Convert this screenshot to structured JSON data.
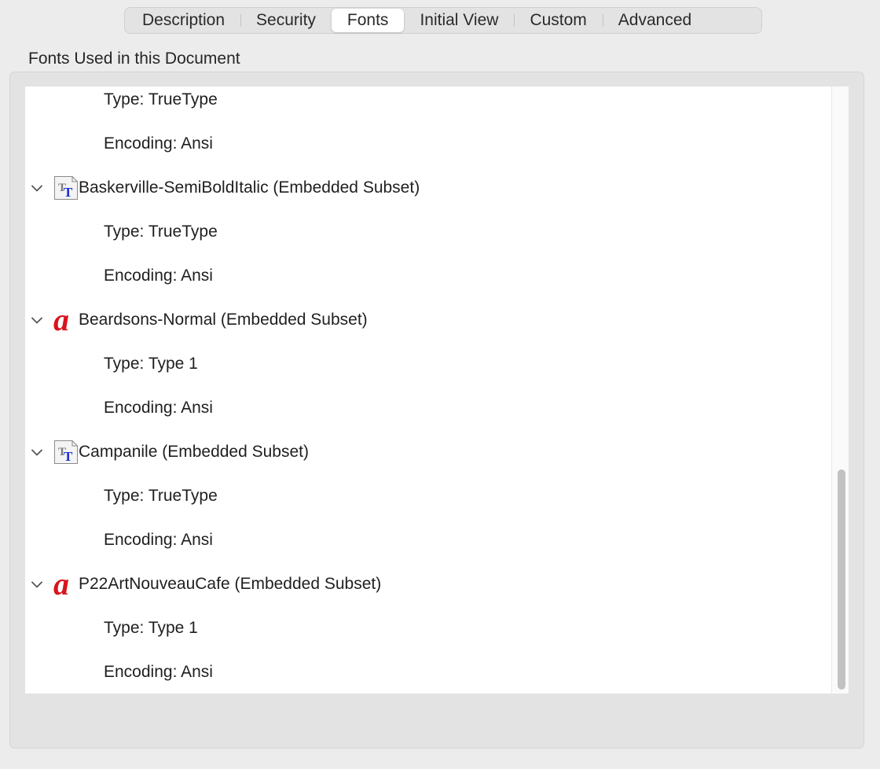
{
  "tabs": [
    {
      "label": "Description",
      "active": false
    },
    {
      "label": "Security",
      "active": false
    },
    {
      "label": "Fonts",
      "active": true
    },
    {
      "label": "Initial View",
      "active": false
    },
    {
      "label": "Custom",
      "active": false
    },
    {
      "label": "Advanced",
      "active": false
    }
  ],
  "section_title": "Fonts Used in this Document",
  "fonts_list": {
    "partial_top": {
      "type": "Type: TrueType",
      "encoding": "Encoding: Ansi"
    },
    "fonts": [
      {
        "name": "Baskerville-SemiBoldItalic (Embedded Subset)",
        "icon": "truetype-font-icon",
        "type": "Type: TrueType",
        "encoding": "Encoding: Ansi"
      },
      {
        "name": "Beardsons-Normal (Embedded Subset)",
        "icon": "type1-font-icon",
        "type": "Type: Type 1",
        "encoding": "Encoding: Ansi"
      },
      {
        "name": "Campanile (Embedded Subset)",
        "icon": "truetype-font-icon",
        "type": "Type: TrueType",
        "encoding": "Encoding: Ansi"
      },
      {
        "name": "P22ArtNouveauCafe (Embedded Subset)",
        "icon": "type1-font-icon",
        "type": "Type: Type 1",
        "encoding": "Encoding: Ansi"
      }
    ]
  },
  "colors": {
    "window_bg": "#ececec",
    "list_bg": "#ffffff",
    "truetype_icon_blue": "#1a2fd6",
    "type1_icon_red": "#d8141c"
  }
}
